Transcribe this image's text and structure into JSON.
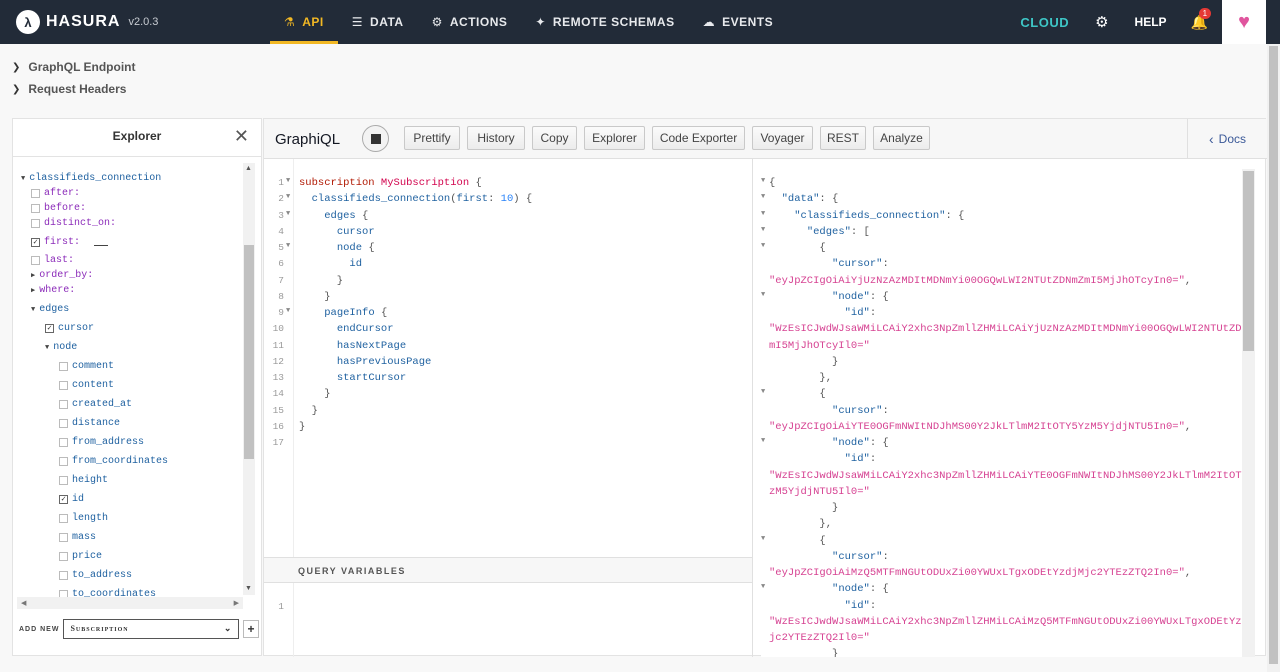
{
  "brand": {
    "logo_letter": "λ",
    "name": "HASURA",
    "version": "v2.0.3"
  },
  "nav": [
    {
      "label": "API",
      "icon": "flask-icon",
      "glyph": "⚗",
      "active": true
    },
    {
      "label": "DATA",
      "icon": "database-icon",
      "glyph": "☰",
      "active": false
    },
    {
      "label": "ACTIONS",
      "icon": "cogs-icon",
      "glyph": "⚙",
      "active": false
    },
    {
      "label": "REMOTE SCHEMAS",
      "icon": "plug-icon",
      "glyph": "✦",
      "active": false
    },
    {
      "label": "EVENTS",
      "icon": "cloud-icon",
      "glyph": "☁",
      "active": false
    }
  ],
  "right_nav": {
    "cloud": "CLOUD",
    "help": "HELP",
    "notifications": "1"
  },
  "toggles": {
    "endpoint": "GraphQL Endpoint",
    "headers": "Request Headers"
  },
  "explorer": {
    "title": "Explorer",
    "rows": [
      {
        "label": "classifieds_connection",
        "kind": "root",
        "indent": 0,
        "marker": "tri-open"
      },
      {
        "label": "after:",
        "kind": "arg",
        "indent": 1,
        "marker": "cb"
      },
      {
        "label": "before:",
        "kind": "arg",
        "indent": 1,
        "marker": "cb"
      },
      {
        "label": "distinct_on:",
        "kind": "arg",
        "indent": 1,
        "marker": "cb"
      },
      {
        "label": "first:",
        "kind": "arg",
        "indent": 1,
        "marker": "cb-on",
        "has_value": true
      },
      {
        "label": "last:",
        "kind": "arg",
        "indent": 1,
        "marker": "cb"
      },
      {
        "label": "order_by:",
        "kind": "arg",
        "indent": 1,
        "marker": "tri-closed"
      },
      {
        "label": "where:",
        "kind": "arg",
        "indent": 1,
        "marker": "tri-closed"
      },
      {
        "label": "edges",
        "kind": "field",
        "indent": 1,
        "marker": "tri-open"
      },
      {
        "label": "cursor",
        "kind": "field",
        "indent": 2,
        "marker": "cb-on"
      },
      {
        "label": "node",
        "kind": "field",
        "indent": 2,
        "marker": "tri-open"
      },
      {
        "label": "comment",
        "kind": "field",
        "indent": 3,
        "marker": "cb"
      },
      {
        "label": "content",
        "kind": "field",
        "indent": 3,
        "marker": "cb"
      },
      {
        "label": "created_at",
        "kind": "field",
        "indent": 3,
        "marker": "cb"
      },
      {
        "label": "distance",
        "kind": "field",
        "indent": 3,
        "marker": "cb"
      },
      {
        "label": "from_address",
        "kind": "field",
        "indent": 3,
        "marker": "cb"
      },
      {
        "label": "from_coordinates",
        "kind": "field",
        "indent": 3,
        "marker": "cb"
      },
      {
        "label": "height",
        "kind": "field",
        "indent": 3,
        "marker": "cb"
      },
      {
        "label": "id",
        "kind": "field",
        "indent": 3,
        "marker": "cb-on"
      },
      {
        "label": "length",
        "kind": "field",
        "indent": 3,
        "marker": "cb"
      },
      {
        "label": "mass",
        "kind": "field",
        "indent": 3,
        "marker": "cb"
      },
      {
        "label": "price",
        "kind": "field",
        "indent": 3,
        "marker": "cb"
      },
      {
        "label": "to_address",
        "kind": "field",
        "indent": 3,
        "marker": "cb"
      },
      {
        "label": "to_coordinates",
        "kind": "field",
        "indent": 3,
        "marker": "cb"
      }
    ],
    "add_new_label": "ADD NEW",
    "add_new_value": "Subscription",
    "add_new_button": "+"
  },
  "graphiql": {
    "title": "GraphiQL",
    "buttons": [
      "Prettify",
      "History",
      "Copy",
      "Explorer",
      "Code Exporter",
      "Voyager",
      "REST",
      "Analyze"
    ],
    "docs": "Docs",
    "variables_title": "QUERY VARIABLES",
    "variables_line": "1"
  },
  "query_lines": [
    {
      "n": "1",
      "fold": true,
      "tokens": [
        [
          "kw",
          "subscription "
        ],
        [
          "def",
          "MySubscription"
        ],
        [
          "punc",
          " {"
        ]
      ]
    },
    {
      "n": "2",
      "fold": true,
      "tokens": [
        [
          "punc",
          "  "
        ],
        [
          "prop",
          "classifieds_connection"
        ],
        [
          "punc",
          "("
        ],
        [
          "prop",
          "first"
        ],
        [
          "punc",
          ": "
        ],
        [
          "num",
          "10"
        ],
        [
          "punc",
          ") {"
        ]
      ]
    },
    {
      "n": "3",
      "fold": true,
      "tokens": [
        [
          "punc",
          "    "
        ],
        [
          "prop",
          "edges"
        ],
        [
          "punc",
          " {"
        ]
      ]
    },
    {
      "n": "4",
      "fold": false,
      "tokens": [
        [
          "punc",
          "      "
        ],
        [
          "prop",
          "cursor"
        ]
      ]
    },
    {
      "n": "5",
      "fold": true,
      "tokens": [
        [
          "punc",
          "      "
        ],
        [
          "prop",
          "node"
        ],
        [
          "punc",
          " {"
        ]
      ]
    },
    {
      "n": "6",
      "fold": false,
      "tokens": [
        [
          "punc",
          "        "
        ],
        [
          "prop",
          "id"
        ]
      ]
    },
    {
      "n": "7",
      "fold": false,
      "tokens": [
        [
          "punc",
          "      }"
        ]
      ]
    },
    {
      "n": "8",
      "fold": false,
      "tokens": [
        [
          "punc",
          "    }"
        ]
      ]
    },
    {
      "n": "9",
      "fold": true,
      "tokens": [
        [
          "punc",
          "    "
        ],
        [
          "prop",
          "pageInfo"
        ],
        [
          "punc",
          " {"
        ]
      ]
    },
    {
      "n": "10",
      "fold": false,
      "tokens": [
        [
          "punc",
          "      "
        ],
        [
          "prop",
          "endCursor"
        ]
      ]
    },
    {
      "n": "11",
      "fold": false,
      "tokens": [
        [
          "punc",
          "      "
        ],
        [
          "prop",
          "hasNextPage"
        ]
      ]
    },
    {
      "n": "12",
      "fold": false,
      "tokens": [
        [
          "punc",
          "      "
        ],
        [
          "prop",
          "hasPreviousPage"
        ]
      ]
    },
    {
      "n": "13",
      "fold": false,
      "tokens": [
        [
          "punc",
          "      "
        ],
        [
          "prop",
          "startCursor"
        ]
      ]
    },
    {
      "n": "14",
      "fold": false,
      "tokens": [
        [
          "punc",
          "    }"
        ]
      ]
    },
    {
      "n": "15",
      "fold": false,
      "tokens": [
        [
          "punc",
          "  }"
        ]
      ]
    },
    {
      "n": "16",
      "fold": false,
      "tokens": [
        [
          "punc",
          "}"
        ]
      ]
    },
    {
      "n": "17",
      "fold": false,
      "tokens": []
    }
  ],
  "result_lines": [
    {
      "fold": true,
      "tokens": [
        [
          "punc",
          "{"
        ]
      ]
    },
    {
      "fold": true,
      "tokens": [
        [
          "punc",
          "  "
        ],
        [
          "key",
          "\"data\""
        ],
        [
          "punc",
          ": {"
        ]
      ]
    },
    {
      "fold": true,
      "tokens": [
        [
          "punc",
          "    "
        ],
        [
          "key",
          "\"classifieds_connection\""
        ],
        [
          "punc",
          ": {"
        ]
      ]
    },
    {
      "fold": true,
      "tokens": [
        [
          "punc",
          "      "
        ],
        [
          "key",
          "\"edges\""
        ],
        [
          "punc",
          ": ["
        ]
      ]
    },
    {
      "fold": true,
      "tokens": [
        [
          "punc",
          "        {"
        ]
      ]
    },
    {
      "fold": false,
      "tokens": [
        [
          "punc",
          "          "
        ],
        [
          "key",
          "\"cursor\""
        ],
        [
          "punc",
          ":"
        ]
      ]
    },
    {
      "fold": false,
      "tokens": [
        [
          "str",
          "\"eyJpZCIgOiAiYjUzNzAzMDItMDNmYi00OGQwLWI2NTUtZDNmZmI5MjJhOTcyIn0=\""
        ],
        [
          "punc",
          ","
        ]
      ]
    },
    {
      "fold": true,
      "tokens": [
        [
          "punc",
          "          "
        ],
        [
          "key",
          "\"node\""
        ],
        [
          "punc",
          ": {"
        ]
      ]
    },
    {
      "fold": false,
      "tokens": [
        [
          "punc",
          "            "
        ],
        [
          "key",
          "\"id\""
        ],
        [
          "punc",
          ":"
        ]
      ]
    },
    {
      "fold": false,
      "tokens": [
        [
          "str",
          "\"WzEsICJwdWJsaWMiLCAiY2xhc3NpZmllZHMiLCAiYjUzNzAzMDItMDNmYi00OGQwLWI2NTUtZDNmZ"
        ]
      ]
    },
    {
      "fold": false,
      "tokens": [
        [
          "str",
          "mI5MjJhOTcyIl0=\""
        ]
      ]
    },
    {
      "fold": false,
      "tokens": [
        [
          "punc",
          "          }"
        ]
      ]
    },
    {
      "fold": false,
      "tokens": [
        [
          "punc",
          "        },"
        ]
      ]
    },
    {
      "fold": true,
      "tokens": [
        [
          "punc",
          "        {"
        ]
      ]
    },
    {
      "fold": false,
      "tokens": [
        [
          "punc",
          "          "
        ],
        [
          "key",
          "\"cursor\""
        ],
        [
          "punc",
          ":"
        ]
      ]
    },
    {
      "fold": false,
      "tokens": [
        [
          "str",
          "\"eyJpZCIgOiAiYTE0OGFmNWItNDJhMS00Y2JkLTlmM2ItOTY5YzM5YjdjNTU5In0=\""
        ],
        [
          "punc",
          ","
        ]
      ]
    },
    {
      "fold": true,
      "tokens": [
        [
          "punc",
          "          "
        ],
        [
          "key",
          "\"node\""
        ],
        [
          "punc",
          ": {"
        ]
      ]
    },
    {
      "fold": false,
      "tokens": [
        [
          "punc",
          "            "
        ],
        [
          "key",
          "\"id\""
        ],
        [
          "punc",
          ":"
        ]
      ]
    },
    {
      "fold": false,
      "tokens": [
        [
          "str",
          "\"WzEsICJwdWJsaWMiLCAiY2xhc3NpZmllZHMiLCAiYTE0OGFmNWItNDJhMS00Y2JkLTlmM2ItOTY5Y"
        ]
      ]
    },
    {
      "fold": false,
      "tokens": [
        [
          "str",
          "zM5YjdjNTU5Il0=\""
        ]
      ]
    },
    {
      "fold": false,
      "tokens": [
        [
          "punc",
          "          }"
        ]
      ]
    },
    {
      "fold": false,
      "tokens": [
        [
          "punc",
          "        },"
        ]
      ]
    },
    {
      "fold": true,
      "tokens": [
        [
          "punc",
          "        {"
        ]
      ]
    },
    {
      "fold": false,
      "tokens": [
        [
          "punc",
          "          "
        ],
        [
          "key",
          "\"cursor\""
        ],
        [
          "punc",
          ":"
        ]
      ]
    },
    {
      "fold": false,
      "tokens": [
        [
          "str",
          "\"eyJpZCIgOiAiMzQ5MTFmNGUtODUxZi00YWUxLTgxODEtYzdjMjc2YTEzZTQ2In0=\""
        ],
        [
          "punc",
          ","
        ]
      ]
    },
    {
      "fold": true,
      "tokens": [
        [
          "punc",
          "          "
        ],
        [
          "key",
          "\"node\""
        ],
        [
          "punc",
          ": {"
        ]
      ]
    },
    {
      "fold": false,
      "tokens": [
        [
          "punc",
          "            "
        ],
        [
          "key",
          "\"id\""
        ],
        [
          "punc",
          ":"
        ]
      ]
    },
    {
      "fold": false,
      "tokens": [
        [
          "str",
          "\"WzEsICJwdWJsaWMiLCAiY2xhc3NpZmllZHMiLCAiMzQ5MTFmNGUtODUxZi00YWUxLTgxODEtYzdjM"
        ]
      ]
    },
    {
      "fold": false,
      "tokens": [
        [
          "str",
          "jc2YTEzZTQ2Il0=\""
        ]
      ]
    },
    {
      "fold": false,
      "tokens": [
        [
          "punc",
          "          }"
        ]
      ]
    }
  ],
  "colors": {
    "topbar": "#222b38",
    "accent": "#f2b824",
    "cloud": "#3ec6c6",
    "heart": "#e0559e",
    "string": "#d64292"
  }
}
